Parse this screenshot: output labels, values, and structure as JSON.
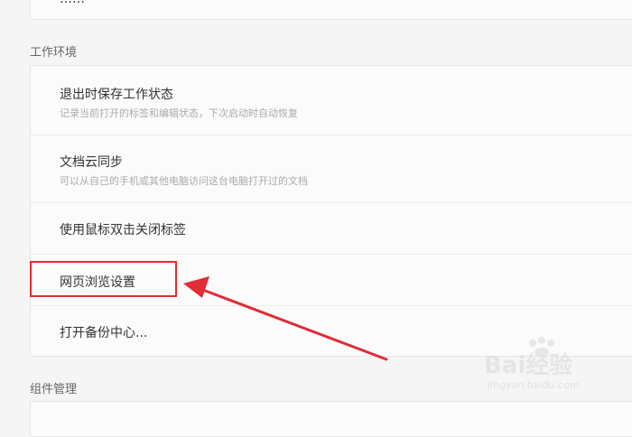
{
  "top_section": {
    "clipped_label": "……"
  },
  "work_env": {
    "title": "工作环境",
    "items": [
      {
        "title": "退出时保存工作状态",
        "subtitle": "记录当前打开的标签和编辑状态，下次启动时自动恢复"
      },
      {
        "title": "文档云同步",
        "subtitle": "可以从自己的手机或其他电脑访问这台电脑打开过的文档"
      },
      {
        "title": "使用鼠标双击关闭标签"
      },
      {
        "title": "网页浏览设置"
      },
      {
        "title": "打开备份中心..."
      }
    ]
  },
  "plugins": {
    "title": "组件管理"
  },
  "annotation": {
    "color": "#e02d36"
  },
  "watermark": {
    "logo": "Bai经验",
    "site": "jingyan.baidu.com"
  }
}
